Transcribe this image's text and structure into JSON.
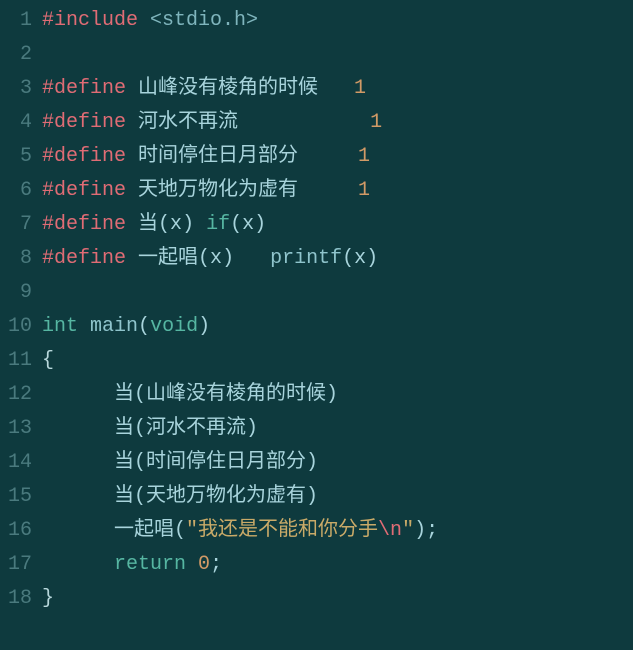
{
  "code": {
    "lines": [
      {
        "num": "1",
        "tokens": [
          {
            "t": "#include",
            "c": "directive"
          },
          {
            "t": " ",
            "c": "plain"
          },
          {
            "t": "<stdio.h>",
            "c": "include-target"
          }
        ]
      },
      {
        "num": "2",
        "tokens": []
      },
      {
        "num": "3",
        "tokens": [
          {
            "t": "#define",
            "c": "directive"
          },
          {
            "t": " ",
            "c": "plain"
          },
          {
            "t": "山峰没有棱角的时候",
            "c": "plain"
          },
          {
            "t": "   ",
            "c": "plain"
          },
          {
            "t": "1",
            "c": "number"
          }
        ]
      },
      {
        "num": "4",
        "tokens": [
          {
            "t": "#define",
            "c": "directive"
          },
          {
            "t": " ",
            "c": "plain"
          },
          {
            "t": "河水不再流",
            "c": "plain"
          },
          {
            "t": "           ",
            "c": "plain"
          },
          {
            "t": "1",
            "c": "number"
          }
        ]
      },
      {
        "num": "5",
        "tokens": [
          {
            "t": "#define",
            "c": "directive"
          },
          {
            "t": " ",
            "c": "plain"
          },
          {
            "t": "时间停住日月部分",
            "c": "plain"
          },
          {
            "t": "     ",
            "c": "plain"
          },
          {
            "t": "1",
            "c": "number"
          }
        ]
      },
      {
        "num": "6",
        "tokens": [
          {
            "t": "#define",
            "c": "directive"
          },
          {
            "t": " ",
            "c": "plain"
          },
          {
            "t": "天地万物化为虚有",
            "c": "plain"
          },
          {
            "t": "     ",
            "c": "plain"
          },
          {
            "t": "1",
            "c": "number"
          }
        ]
      },
      {
        "num": "7",
        "tokens": [
          {
            "t": "#define",
            "c": "directive"
          },
          {
            "t": " ",
            "c": "plain"
          },
          {
            "t": "当",
            "c": "plain"
          },
          {
            "t": "(",
            "c": "paren"
          },
          {
            "t": "x",
            "c": "ident"
          },
          {
            "t": ")",
            "c": "paren"
          },
          {
            "t": " ",
            "c": "plain"
          },
          {
            "t": "if",
            "c": "keyword"
          },
          {
            "t": "(",
            "c": "paren"
          },
          {
            "t": "x",
            "c": "ident"
          },
          {
            "t": ")",
            "c": "paren"
          }
        ]
      },
      {
        "num": "8",
        "tokens": [
          {
            "t": "#define",
            "c": "directive"
          },
          {
            "t": " ",
            "c": "plain"
          },
          {
            "t": "一起唱",
            "c": "plain"
          },
          {
            "t": "(",
            "c": "paren"
          },
          {
            "t": "x",
            "c": "ident"
          },
          {
            "t": ")",
            "c": "paren"
          },
          {
            "t": "   ",
            "c": "plain"
          },
          {
            "t": "printf",
            "c": "func"
          },
          {
            "t": "(",
            "c": "paren"
          },
          {
            "t": "x",
            "c": "ident"
          },
          {
            "t": ")",
            "c": "paren"
          }
        ]
      },
      {
        "num": "9",
        "tokens": []
      },
      {
        "num": "10",
        "tokens": [
          {
            "t": "int",
            "c": "type"
          },
          {
            "t": " ",
            "c": "plain"
          },
          {
            "t": "main",
            "c": "func"
          },
          {
            "t": "(",
            "c": "paren"
          },
          {
            "t": "void",
            "c": "type"
          },
          {
            "t": ")",
            "c": "paren"
          }
        ]
      },
      {
        "num": "11",
        "tokens": [
          {
            "t": "{",
            "c": "brace"
          }
        ]
      },
      {
        "num": "12",
        "tokens": [
          {
            "t": "      ",
            "c": "plain"
          },
          {
            "t": "当",
            "c": "plain"
          },
          {
            "t": "(",
            "c": "paren"
          },
          {
            "t": "山峰没有棱角的时候",
            "c": "ident"
          },
          {
            "t": ")",
            "c": "paren"
          }
        ]
      },
      {
        "num": "13",
        "tokens": [
          {
            "t": "      ",
            "c": "plain"
          },
          {
            "t": "当",
            "c": "plain"
          },
          {
            "t": "(",
            "c": "paren"
          },
          {
            "t": "河水不再流",
            "c": "ident"
          },
          {
            "t": ")",
            "c": "paren"
          }
        ]
      },
      {
        "num": "14",
        "tokens": [
          {
            "t": "      ",
            "c": "plain"
          },
          {
            "t": "当",
            "c": "plain"
          },
          {
            "t": "(",
            "c": "paren"
          },
          {
            "t": "时间停住日月部分",
            "c": "ident"
          },
          {
            "t": ")",
            "c": "paren"
          }
        ]
      },
      {
        "num": "15",
        "tokens": [
          {
            "t": "      ",
            "c": "plain"
          },
          {
            "t": "当",
            "c": "plain"
          },
          {
            "t": "(",
            "c": "paren"
          },
          {
            "t": "天地万物化为虚有",
            "c": "ident"
          },
          {
            "t": ")",
            "c": "paren"
          }
        ]
      },
      {
        "num": "16",
        "tokens": [
          {
            "t": "      ",
            "c": "plain"
          },
          {
            "t": "一起唱",
            "c": "plain"
          },
          {
            "t": "(",
            "c": "paren"
          },
          {
            "t": "\"我还是不能和你分手",
            "c": "string"
          },
          {
            "t": "\\n",
            "c": "escape"
          },
          {
            "t": "\"",
            "c": "string"
          },
          {
            "t": ")",
            "c": "paren"
          },
          {
            "t": ";",
            "c": "plain"
          }
        ]
      },
      {
        "num": "17",
        "tokens": [
          {
            "t": "      ",
            "c": "plain"
          },
          {
            "t": "return",
            "c": "keyword"
          },
          {
            "t": " ",
            "c": "plain"
          },
          {
            "t": "0",
            "c": "number"
          },
          {
            "t": ";",
            "c": "plain"
          }
        ]
      },
      {
        "num": "18",
        "tokens": [
          {
            "t": "}",
            "c": "brace"
          }
        ]
      }
    ]
  }
}
